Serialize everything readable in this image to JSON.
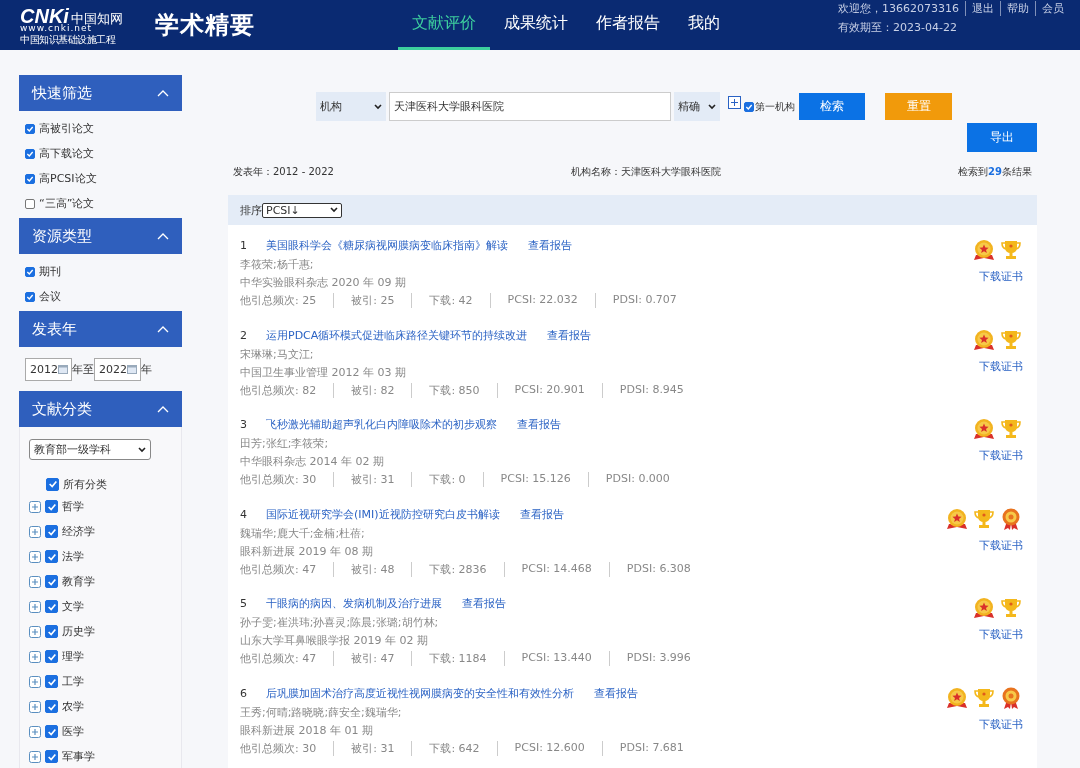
{
  "header": {
    "logo_mark": "CNKi",
    "logo_cn": "中国知网",
    "logo_url": "www.cnki.net",
    "logo_sub": "中国知识基础设施工程",
    "product": "学术精要",
    "nav": [
      {
        "label": "文献评价",
        "selected": true
      },
      {
        "label": "成果统计",
        "selected": false
      },
      {
        "label": "作者报告",
        "selected": false
      },
      {
        "label": "我的",
        "selected": false
      }
    ],
    "user": "欢迎您，13662073316",
    "links": [
      "退出",
      "帮助",
      "会员"
    ],
    "expiry": "有效期至：2023-04-22"
  },
  "sidebar": {
    "sections": [
      {
        "title": "快速筛选",
        "expanded": true,
        "kind": "checks",
        "items": [
          {
            "label": "高被引论文",
            "checked": true
          },
          {
            "label": "高下载论文",
            "checked": true
          },
          {
            "label": "高PCSI论文",
            "checked": true
          },
          {
            "label": "“三高”论文",
            "checked": false
          }
        ]
      },
      {
        "title": "资源类型",
        "expanded": true,
        "kind": "checks",
        "items": [
          {
            "label": "期刊",
            "checked": true
          },
          {
            "label": "会议",
            "checked": true
          }
        ]
      },
      {
        "title": "发表年",
        "expanded": true,
        "kind": "years",
        "from": "2012",
        "to": "2022",
        "sep": "年至",
        "suffix": "年"
      },
      {
        "title": "文献分类",
        "expanded": true,
        "kind": "tree",
        "select": "教育部一级学科",
        "tree": {
          "label": "所有分类",
          "checked": true,
          "children": [
            {
              "label": "哲学",
              "checked": true,
              "expanded": false
            },
            {
              "label": "经济学",
              "checked": true,
              "expanded": false
            },
            {
              "label": "法学",
              "checked": true,
              "expanded": false
            },
            {
              "label": "教育学",
              "checked": true,
              "expanded": false
            },
            {
              "label": "文学",
              "checked": true,
              "expanded": false
            },
            {
              "label": "历史学",
              "checked": true,
              "expanded": false
            },
            {
              "label": "理学",
              "checked": true,
              "expanded": false
            },
            {
              "label": "工学",
              "checked": true,
              "expanded": false
            },
            {
              "label": "农学",
              "checked": true,
              "expanded": false
            },
            {
              "label": "医学",
              "checked": true,
              "expanded": false
            },
            {
              "label": "军事学",
              "checked": true,
              "expanded": false
            }
          ]
        }
      }
    ]
  },
  "search": {
    "field": "机构",
    "value": "天津医科大学眼科医院",
    "mode": "精确",
    "first_org": {
      "label": "第一机构",
      "checked": true
    },
    "buttons": [
      "检索",
      "重置"
    ],
    "export": "导出"
  },
  "summary": {
    "years": "发表年：2012 - 2022",
    "org": "机构名称：天津医科大学眼科医院",
    "count": "检索到**29**条结果"
  },
  "sort": {
    "label": "排序",
    "value": "PCSI↓"
  },
  "results": [
    {
      "index": "1",
      "title": "美国眼科学会《糖尿病视网膜病变临床指南》解读",
      "report": "查看报告",
      "authors": "李筱荣;杨千惠;",
      "source": "中华实验眼科杂志 2020 年 09 期",
      "stats": [
        "他引总频次: 25",
        "被引: 25",
        "下载: 42",
        "PCSI: 22.032",
        "PDSI: 0.707"
      ],
      "badges": [
        {
          "kind": "medal"
        },
        {
          "kind": "trophy"
        }
      ],
      "cert": "下载证书"
    },
    {
      "index": "2",
      "title": "运用PDCA循环模式促进临床路径关键环节的持续改进",
      "report": "查看报告",
      "authors": "宋琳琳;马文江;",
      "source": "中国卫生事业管理 2012 年 03 期",
      "stats": [
        "他引总频次: 82",
        "被引: 82",
        "下载: 850",
        "PCSI: 20.901",
        "PDSI: 8.945"
      ],
      "badges": [
        {
          "kind": "medal"
        },
        {
          "kind": "trophy"
        }
      ],
      "cert": "下载证书"
    },
    {
      "index": "3",
      "title": "飞秒激光辅助超声乳化白内障吸除术的初步观察",
      "report": "查看报告",
      "authors": "田芳;张红;李筱荣;",
      "source": "中华眼科杂志 2014 年 02 期",
      "stats": [
        "他引总频次: 30",
        "被引: 31",
        "下载: 0",
        "PCSI: 15.126",
        "PDSI: 0.000"
      ],
      "badges": [
        {
          "kind": "medal"
        },
        {
          "kind": "trophy"
        }
      ],
      "cert": "下载证书"
    },
    {
      "index": "4",
      "title": "国际近视研究学会(IMI)近视防控研究白皮书解读",
      "report": "查看报告",
      "authors": "魏瑞华;鹿大千;金楠;杜蓓;",
      "source": "眼科新进展 2019 年 08 期",
      "stats": [
        "他引总频次: 47",
        "被引: 48",
        "下载: 2836",
        "PCSI: 14.468",
        "PDSI: 6.308"
      ],
      "badges": [
        {
          "kind": "medal"
        },
        {
          "kind": "trophy"
        },
        {
          "kind": "rosette"
        }
      ],
      "cert": "下载证书"
    },
    {
      "index": "5",
      "title": "干眼病的病因、发病机制及治疗进展",
      "report": "查看报告",
      "authors": "孙子雯;崔洪玮;孙喜灵;陈晨;张璐;胡竹林;",
      "source": "山东大学耳鼻喉眼学报 2019 年 02 期",
      "stats": [
        "他引总频次: 47",
        "被引: 47",
        "下载: 1184",
        "PCSI: 13.440",
        "PDSI: 3.996"
      ],
      "badges": [
        {
          "kind": "medal"
        },
        {
          "kind": "trophy"
        }
      ],
      "cert": "下载证书"
    },
    {
      "index": "6",
      "title": "后巩膜加固术治疗高度近视性视网膜病变的安全性和有效性分析",
      "report": "查看报告",
      "authors": "王秀;何晴;路晓晓;薛安全;魏瑞华;",
      "source": "眼科新进展 2018 年 01 期",
      "stats": [
        "他引总频次: 30",
        "被引: 31",
        "下载: 642",
        "PCSI: 12.600",
        "PDSI: 7.681"
      ],
      "badges": [
        {
          "kind": "medal"
        },
        {
          "kind": "trophy"
        },
        {
          "kind": "rosette"
        }
      ],
      "cert": "下载证书"
    }
  ]
}
